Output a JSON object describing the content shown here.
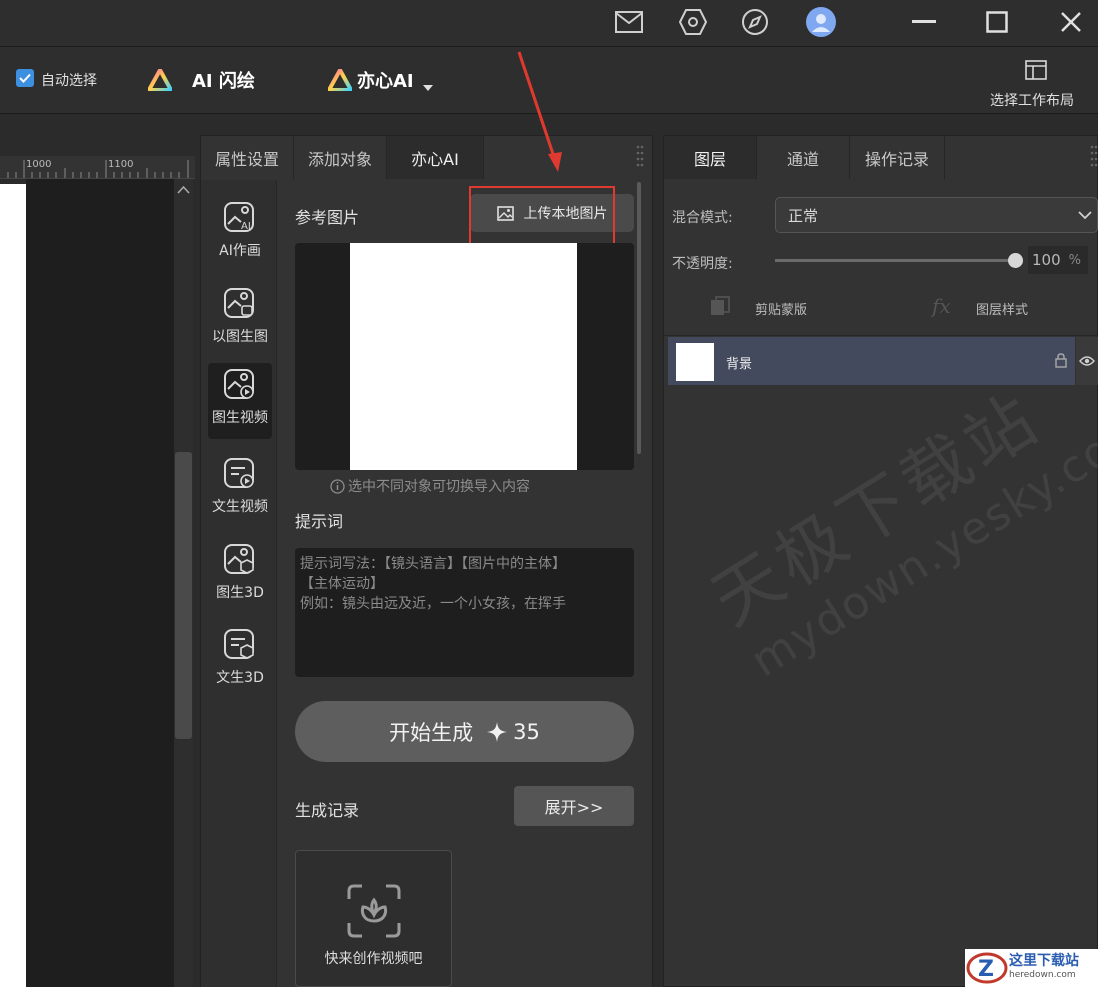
{
  "toolbar": {
    "auto_select_label": "自动选择",
    "brand_flash": "AI 闪绘",
    "brand_yixin": "亦心AI",
    "layout_label": "选择工作布局"
  },
  "ruler": {
    "ticks": [
      "1000",
      "1100"
    ]
  },
  "mid_panel": {
    "tabs": [
      "属性设置",
      "添加对象",
      "亦心AI"
    ],
    "nav": [
      "AI作画",
      "以图生图",
      "图生视频",
      "文生视频",
      "图生3D",
      "文生3D"
    ],
    "ref_label": "参考图片",
    "upload_label": "上传本地图片",
    "hint": "选中不同对象可切换导入内容",
    "prompt_label": "提示词",
    "prompt_placeholder_line1": "提示词写法：【镜头语言】【图片中的主体】",
    "prompt_placeholder_line2": "【主体运动】",
    "prompt_placeholder_line3": "例如：镜头由远及近，一个小女孩，在挥手",
    "generate_label": "开始生成",
    "generate_cost": "35",
    "history_label": "生成记录",
    "expand_label": "展开>>",
    "history_empty": "快来创作视频吧"
  },
  "right_panel": {
    "tabs": [
      "图层",
      "通道",
      "操作记录"
    ],
    "blend_label": "混合模式:",
    "blend_value": "正常",
    "opacity_label": "不透明度:",
    "opacity_value": "100",
    "opacity_unit": "%",
    "opacity_level": 1.0,
    "clip_mask": "剪贴蒙版",
    "layer_style": "图层样式",
    "layer_name": "背景"
  },
  "watermark": {
    "line1": "天极下载站",
    "line2": "mydown.yesky.com"
  },
  "corner_logo": {
    "text": "这里下载站",
    "url_text": "heredown.com"
  },
  "colors": {
    "accent": "#3d8fe0",
    "highlight_box": "#e03a30",
    "selected_layer": "#434a5e"
  }
}
